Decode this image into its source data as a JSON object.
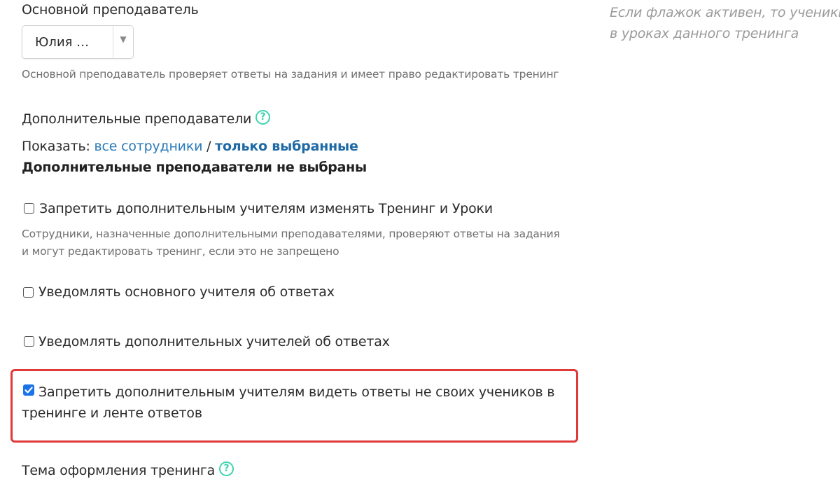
{
  "main_teacher": {
    "label": "Основной преподаватель",
    "selected_value": "Юлия …",
    "caret": "▼",
    "help_text": "Основной преподаватель проверяет ответы на задания и имеет право редактировать тренинг"
  },
  "additional_teachers": {
    "label": "Дополнительные преподаватели",
    "help_icon": "?",
    "show_prefix": "Показать:",
    "show_all": "все сотрудники",
    "show_separator": "/",
    "show_selected": "только выбранные",
    "none_selected": "Дополнительные преподаватели не выбраны"
  },
  "options": {
    "forbid_edit": {
      "label": "Запретить дополнительным учителям изменять Тренинг и Уроки",
      "checked": false,
      "help_line1": "Сотрудники, назначенные дополнительными преподавателями, проверяют ответы на задания",
      "help_line2": "и могут редактировать тренинг, если это не запрещено"
    },
    "notify_main": {
      "label": "Уведомлять основного учителя об ответах",
      "checked": false
    },
    "notify_additional": {
      "label": "Уведомлять дополнительных учителей об ответах",
      "checked": false
    },
    "forbid_view": {
      "label": "Запретить дополнительным учителям видеть ответы не своих учеников в тренинге и ленте ответов",
      "checked": true
    }
  },
  "theme": {
    "label": "Тема оформления тренинга",
    "help_icon": "?"
  },
  "side_hint": {
    "line1": "Если флажок активен, то ученики",
    "line2": "в уроках данного тренинга"
  },
  "colors": {
    "accent_teal": "#3fd3b0",
    "link_blue": "#2a7ab8",
    "checkbox_blue": "#1a73e8",
    "highlight_red": "#e0393a"
  }
}
